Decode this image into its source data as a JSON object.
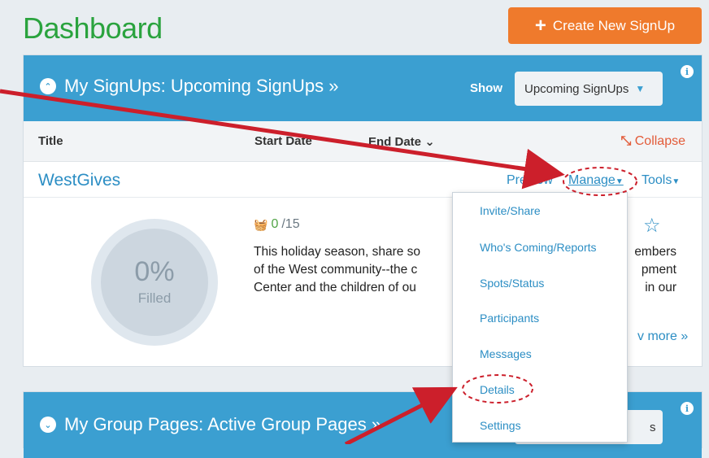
{
  "page": {
    "title": "Dashboard"
  },
  "create_button": {
    "icon": "plus-icon",
    "label": "Create New SignUp"
  },
  "signups_panel": {
    "title": "My SignUps: Upcoming SignUps »",
    "show_label": "Show",
    "show_selected": "Upcoming SignUps",
    "columns": {
      "title": "Title",
      "start_date": "Start Date",
      "end_date": "End Date",
      "collapse": "Collapse"
    },
    "signup": {
      "name": "WestGives",
      "preview": "Preview",
      "manage": "Manage",
      "tools": "Tools",
      "filled_percent": "0%",
      "filled_label": "Filled",
      "slots_filled": "0",
      "slots_total": "/15",
      "description_lines": [
        "This holiday season, share so",
        "of the West community--the c",
        "Center and the children of ou"
      ],
      "description_right_lines": [
        "embers",
        "pment",
        "in our"
      ],
      "more_link": "v more »"
    }
  },
  "manage_menu": {
    "items": [
      "Invite/Share",
      "Who's Coming/Reports",
      "Spots/Status",
      "Participants",
      "Messages",
      "Details",
      "Settings"
    ]
  },
  "group_panel": {
    "title": "My Group Pages: Active Group Pages »",
    "show_partial": "s"
  },
  "colors": {
    "brand_green": "#2aa33e",
    "accent_orange": "#ef7a2c",
    "panel_blue": "#3b9fd1",
    "link_blue": "#2c8ec4",
    "annotation_red": "#cc1f2b"
  }
}
